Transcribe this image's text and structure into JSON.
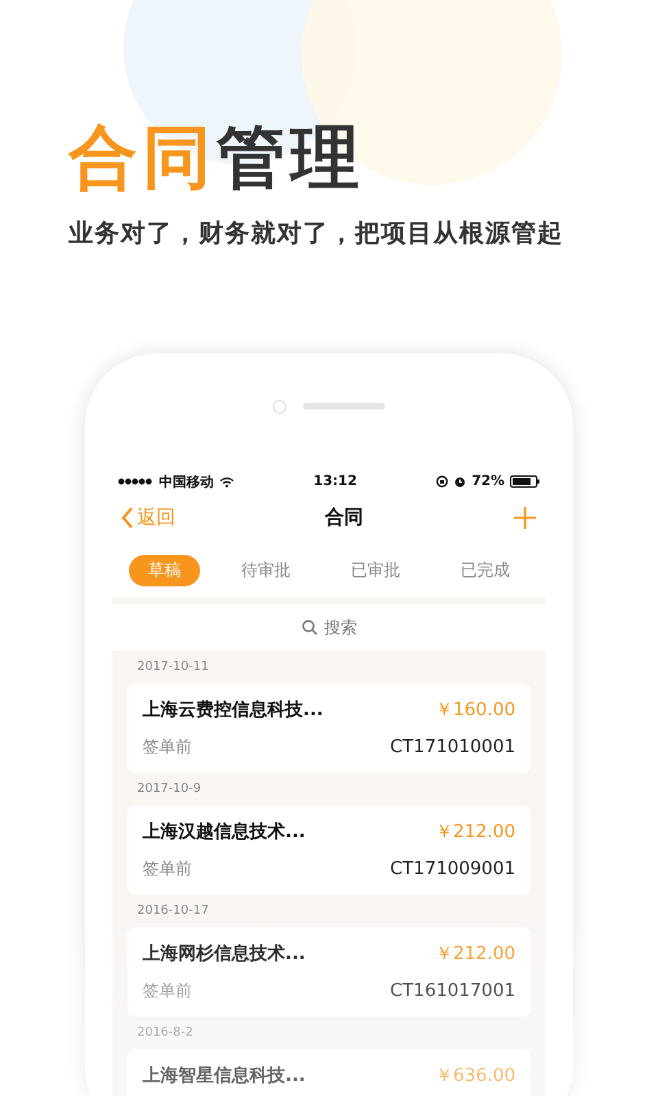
{
  "headline": {
    "accent": "合同",
    "rest": "管理"
  },
  "subtitle": "业务对了，财务就对了，把项目从根源管起",
  "status_bar": {
    "carrier": "中国移动",
    "time": "13:12",
    "battery": "72%"
  },
  "nav": {
    "back": "返回",
    "title": "合同"
  },
  "tabs": [
    {
      "label": "草稿",
      "selected": true
    },
    {
      "label": "待审批",
      "selected": false
    },
    {
      "label": "已审批",
      "selected": false
    },
    {
      "label": "已完成",
      "selected": false
    }
  ],
  "search": {
    "placeholder": "搜索"
  },
  "contracts": [
    {
      "date": "2017-10-11",
      "name": "上海云费控信息科技...",
      "amount": "￥160.00",
      "status": "签单前",
      "code": "CT171010001"
    },
    {
      "date": "2017-10-9",
      "name": "上海汉越信息技术...",
      "amount": "￥212.00",
      "status": "签单前",
      "code": "CT171009001"
    },
    {
      "date": "2016-10-17",
      "name": "上海网杉信息技术...",
      "amount": "￥212.00",
      "status": "签单前",
      "code": "CT161017001"
    },
    {
      "date": "2016-8-2",
      "name": "上海智星信息科技...",
      "amount": "￥636.00"
    }
  ]
}
